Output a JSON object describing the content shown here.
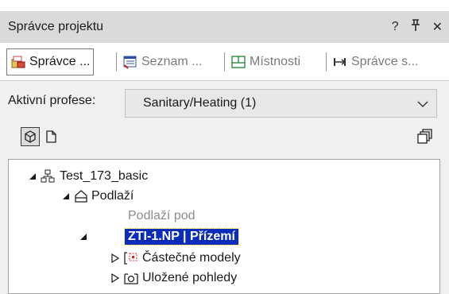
{
  "window": {
    "title": "Správce projektu",
    "help": "?",
    "pin": "ᵖ",
    "close": "✕"
  },
  "tabs": [
    {
      "label": "Správce ...",
      "icon": "project-manager-icon",
      "active": true
    },
    {
      "label": "Seznam ...",
      "icon": "list-icon",
      "active": false
    },
    {
      "label": "Místnosti",
      "icon": "rooms-icon",
      "active": false
    },
    {
      "label": "Správce s...",
      "icon": "connection-manager-icon",
      "active": false
    }
  ],
  "profession": {
    "label": "Aktivní profese:",
    "selected": "Sanitary/Heating (1)"
  },
  "toolbar": {
    "view3d_icon": "cube-icon",
    "view2d_icon": "document-icon",
    "windows_icon": "stacked-windows-icon"
  },
  "tree": {
    "root": "Test_173_basic",
    "floors": "Podlaží",
    "floor_under": "Podlaží pod",
    "selected_floor": "ZTI-1.NP | Přízemí",
    "partial_models": "Částečné modely",
    "saved_views": "Uložené pohledy"
  },
  "colors": {
    "selection": "#0a2cb8",
    "accent_red": "#d02020",
    "accent_green": "#2e8b3e"
  }
}
